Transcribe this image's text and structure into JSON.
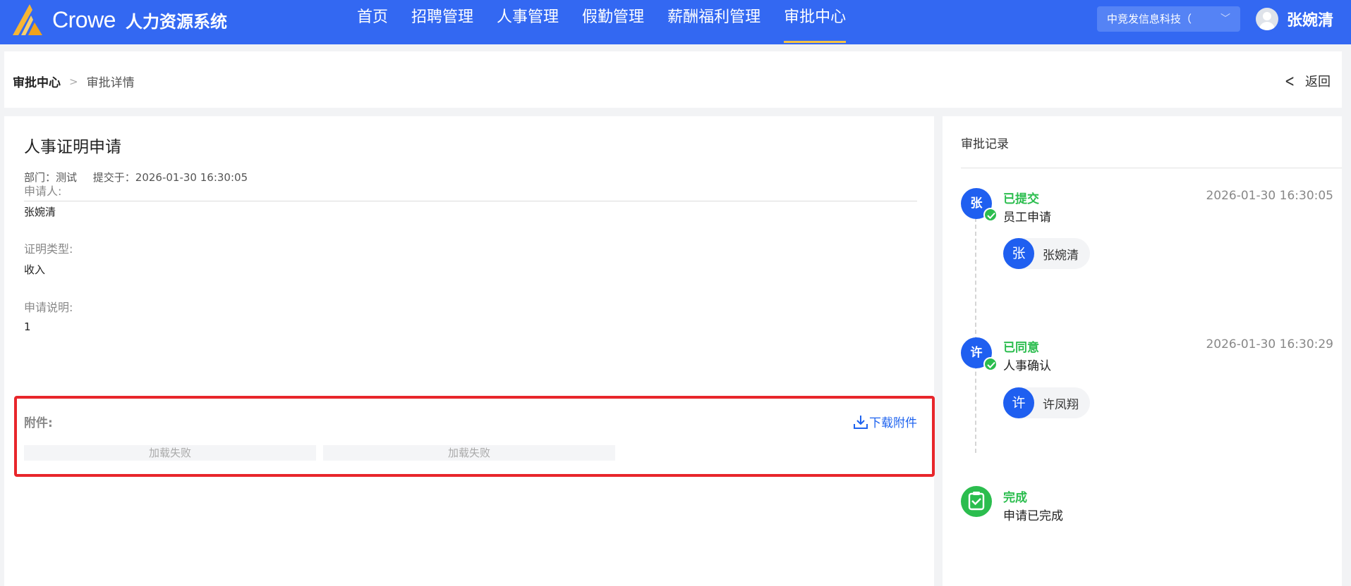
{
  "header": {
    "logo_text": "Crowe",
    "system_name": "人力资源系统",
    "nav": [
      "首页",
      "招聘管理",
      "人事管理",
      "假勤管理",
      "薪酬福利管理",
      "审批中心"
    ],
    "company": "中竞发信息科技（",
    "user_name": "张婉清"
  },
  "breadcrumb": {
    "root": "审批中心",
    "current": "审批详情",
    "back": "返回"
  },
  "detail": {
    "title": "人事证明申请",
    "department": "部门：测试",
    "submitted": "提交于：2026-01-30 16:30:05",
    "fields": [
      {
        "label": "申请人:",
        "value": "张婉清"
      },
      {
        "label": "证明类型:",
        "value": "收入"
      },
      {
        "label": "申请说明:",
        "value": "1"
      }
    ],
    "attachment_label": "附件:",
    "download_label": "下载附件",
    "attachments": [
      "加载失败",
      "加载失败"
    ]
  },
  "records": {
    "title": "审批记录",
    "items": [
      {
        "avatar": "张",
        "status": "已提交",
        "step": "员工申请",
        "time": "2026-01-30 16:30:05",
        "person_avatar": "张",
        "person": "张婉清"
      },
      {
        "avatar": "许",
        "status": "已同意",
        "step": "人事确认",
        "time": "2026-01-30 16:30:29",
        "person_avatar": "许",
        "person": "许凤翔"
      },
      {
        "status": "完成",
        "step": "申请已完成"
      }
    ]
  },
  "colors": {
    "header_bg": "#3368f2",
    "active_underline": "#f5c242",
    "primary": "#1f5ff0",
    "success": "#2bbd4e",
    "highlight": "#e8262b"
  }
}
